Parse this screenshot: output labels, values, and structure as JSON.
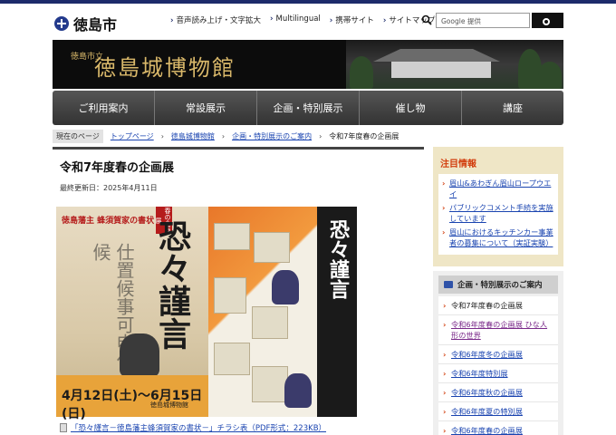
{
  "header": {
    "site_name": "徳島市",
    "links": [
      "音声読み上げ・文字拡大",
      "Multilingual",
      "携帯サイト",
      "サイトマップ"
    ],
    "search_placeholder": "Google 提供"
  },
  "banner": {
    "emblem": "徳島市立",
    "title": "徳島城博物館"
  },
  "nav": [
    "ご利用案内",
    "常設展示",
    "企画・特別展示",
    "催し物",
    "講座"
  ],
  "breadcrumb": {
    "label": "現在のページ",
    "items": [
      "トップページ",
      "徳島城博物館",
      "企画・特別展示のご案内"
    ],
    "current": "令和7年度春の企画展"
  },
  "main": {
    "title": "令和7年度春の企画展",
    "updated": "最終更新日：2025年4月11日",
    "poster": {
      "subtitle": "徳島藩主 蜂須賀家の書状",
      "tag": "春の企画展",
      "big_text": "恐々謹言",
      "dates": "4月12日(土)〜6月15日(日)",
      "museum": "徳島城博物館"
    },
    "pdf_link": "「恐々謹言－徳島藩主蜂須賀家の書状－」チラシ表（PDF形式：223KB）"
  },
  "side": {
    "attention_title": "注目情報",
    "attention_items": [
      "眉山&あわぎん眉山ロープウエイ",
      "パブリックコメント手続を実施しています",
      "眉山におけるキッチンカー事業者の募集について（実証実験）"
    ],
    "exhibit_title": "企画・特別展示のご案内",
    "exhibit_items": [
      "令和7年度春の企画展",
      "令和6年度春の企画展 ひな人形の世界",
      "令和6年度冬の企画展",
      "令和6年度特別展",
      "令和6年度秋の企画展",
      "令和6年度夏の特別展",
      "令和6年度春の企画展"
    ]
  },
  "colors": {
    "accent": "#1d2b6b",
    "attention_red": "#d23e0e",
    "nav_bg": "#444444",
    "banner_gold": "#d9b86a"
  }
}
